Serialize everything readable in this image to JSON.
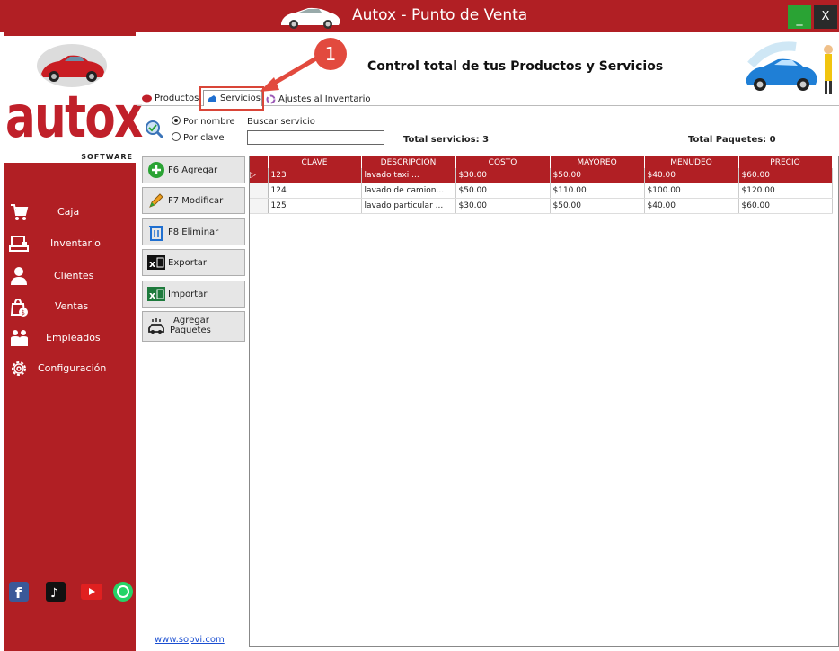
{
  "window": {
    "title": "Autox - Punto de Venta",
    "minimize": "_",
    "close": "X"
  },
  "logo": {
    "word": "autox",
    "sub": "SOFTWARE"
  },
  "sidebar": {
    "items": [
      {
        "label": "Caja",
        "icon": "cart-icon"
      },
      {
        "label": "Inventario",
        "icon": "register-icon"
      },
      {
        "label": "Clientes",
        "icon": "user-icon"
      },
      {
        "label": "Ventas",
        "icon": "money-bag-icon"
      },
      {
        "label": "Empleados",
        "icon": "employees-icon"
      },
      {
        "label": "Configuración",
        "icon": "gear-icon"
      }
    ],
    "website": "www.sopvi.com"
  },
  "header": {
    "title": "Control total de tus Productos y Servicios"
  },
  "callout": {
    "number": "1"
  },
  "tabs": [
    {
      "label": "Productos"
    },
    {
      "label": "Servicios"
    },
    {
      "label": "Ajustes al Inventario"
    }
  ],
  "search": {
    "option_name": "Por nombre",
    "option_code": "Por clave",
    "label": "Buscar servicio",
    "value": ""
  },
  "totals": {
    "services": "Total servicios: 3",
    "packages": "Total Paquetes: 0"
  },
  "actions": {
    "add": "F6 Agregar",
    "edit": "F7 Modificar",
    "delete": "F8 Eliminar",
    "export": "Exportar",
    "import": "Importar",
    "packages_line1": "Agregar",
    "packages_line2": "Paquetes"
  },
  "grid": {
    "columns": [
      "CLAVE",
      "DESCRIPCION",
      "COSTO",
      "MAYOREO",
      "MENUDEO",
      "PRECIO"
    ],
    "rows": [
      [
        "123",
        "lavado taxi          ...",
        "$30.00",
        "$50.00",
        "$40.00",
        "$60.00"
      ],
      [
        "124",
        "lavado de camion...",
        "$50.00",
        "$110.00",
        "$100.00",
        "$120.00"
      ],
      [
        "125",
        "lavado particular  ...",
        "$30.00",
        "$50.00",
        "$40.00",
        "$60.00"
      ]
    ]
  },
  "colors": {
    "brand_red": "#b11f24",
    "accent_green": "#2aa334",
    "callout": "#e24a3e"
  }
}
